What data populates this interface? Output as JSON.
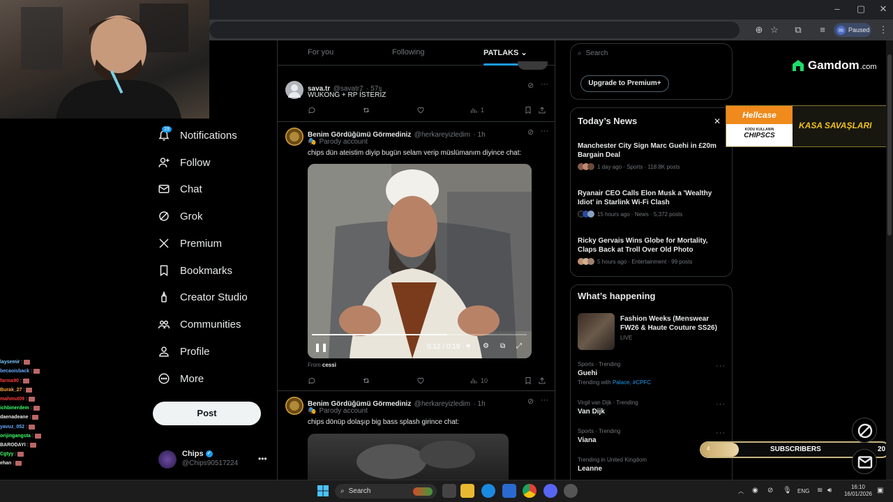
{
  "browser": {
    "paused_label": "Paused",
    "profile_initial": "m"
  },
  "stream": {
    "chat": [
      {
        "user": "",
        "color": "#1db954"
      },
      {
        "user": "laysemir",
        "color": "#7ec8ff"
      },
      {
        "user": "becaoisback",
        "color": "#6aa9ff"
      },
      {
        "user": "farma90",
        "color": "#ff3d3d"
      },
      {
        "user": "Burak_27",
        "color": "#ffaa44"
      },
      {
        "user": "mahmut09",
        "color": "#ff3d3d"
      },
      {
        "user": "ichbinerdem",
        "color": "#3dff6a"
      },
      {
        "user": "daenadeane",
        "color": "#e7e7e7"
      },
      {
        "user": "yavuz_052",
        "color": "#6aa9ff"
      },
      {
        "user": "orijingangsta",
        "color": "#3dff6a"
      },
      {
        "user": "BARODAYI",
        "color": "#e7e7e7"
      },
      {
        "user": "Cgtyy",
        "color": "#3dff6a"
      },
      {
        "user": "ehan",
        "color": "#e7e7e7"
      }
    ]
  },
  "sidebar": {
    "items": [
      {
        "label": "Notifications",
        "icon": "bell-icon",
        "badge": "19"
      },
      {
        "label": "Follow",
        "icon": "follow-icon"
      },
      {
        "label": "Chat",
        "icon": "mail-icon"
      },
      {
        "label": "Grok",
        "icon": "grok-icon"
      },
      {
        "label": "Premium",
        "icon": "x-logo-icon"
      },
      {
        "label": "Bookmarks",
        "icon": "bookmark-icon"
      },
      {
        "label": "Creator Studio",
        "icon": "creator-icon"
      },
      {
        "label": "Communities",
        "icon": "communities-icon"
      },
      {
        "label": "Profile",
        "icon": "profile-icon"
      },
      {
        "label": "More",
        "icon": "more-circle-icon"
      }
    ],
    "post_label": "Post",
    "account": {
      "name": "Chips",
      "handle": "@Chips90517224"
    }
  },
  "timeline": {
    "tabs": [
      {
        "label": "For you"
      },
      {
        "label": "Following"
      },
      {
        "label": "PATLAKS"
      }
    ],
    "posts": [
      {
        "name": "sava.tr",
        "handle": "@savatr7",
        "time": "· 57s",
        "text": "WUKONG + RP İSTERİZ",
        "views": "1"
      },
      {
        "name": "Benim Gördüğümü Görmediniz",
        "handle": "@herkareyizledim",
        "time": "· 1h",
        "label": "Parody account",
        "text": "chips dün ateistim diyip bugün selam verip müslümanım diyince chat:",
        "video": {
          "time": "0:12 / 0:19",
          "progress": 0.63
        },
        "from_label": "From",
        "from_name": "cessi",
        "views": "10"
      },
      {
        "name": "Benim Gördüğümü Görmediniz",
        "handle": "@herkareyizledim",
        "time": "· 1h",
        "label": "Parody account",
        "text": "chips dönüp dolaşıp big bass splash girince chat:"
      }
    ]
  },
  "right": {
    "search_placeholder": "Search",
    "upgrade_label": "Upgrade to Premium+",
    "news_title": "Today’s News",
    "news": [
      {
        "headline": "Manchester City Sign Marc Guehi in £20m Bargain Deal",
        "meta": "1 day ago · Sports · 118.8K posts"
      },
      {
        "headline": "Ryanair CEO Calls Elon Musk a 'Wealthy Idiot' in Starlink Wi-Fi Clash",
        "meta": "15 hours ago · News · 5,372 posts"
      },
      {
        "headline": "Ricky Gervais Wins Globe for Mortality, Claps Back at Troll Over Old Photo",
        "meta": "5 hours ago · Entertainment · 99 posts"
      }
    ],
    "happening_title": "What’s happening",
    "event": {
      "title": "Fashion Weeks (Menswear FW26 & Haute Couture SS26)",
      "status": "LIVE"
    },
    "trends": [
      {
        "category": "Sports · Trending",
        "name": "Guehi",
        "with_prefix": "Trending with",
        "with_tags": "Palace, #CPFC"
      },
      {
        "category": "Virgil van Dijk · Trending",
        "name": "Van Dijk"
      },
      {
        "category": "Sports · Trending",
        "name": "Viana"
      },
      {
        "category": "Trending in United Kingdom",
        "name": "Leanne"
      }
    ]
  },
  "overlays": {
    "gamdom": {
      "text": "Gamdom",
      "suffix": ".com"
    },
    "hellcase": {
      "brand": "Hellcase",
      "code_label": "KODU KULLANIN",
      "code": "CHIPSCS",
      "slogan": "KASA SAVAŞLARI"
    },
    "subscribers": {
      "label": "SUBSCRIBERS",
      "current": "4",
      "goal": "20"
    }
  },
  "taskbar": {
    "search_label": "Search",
    "lang": "ENG",
    "time": "16:10",
    "date": "16/01/2026"
  }
}
